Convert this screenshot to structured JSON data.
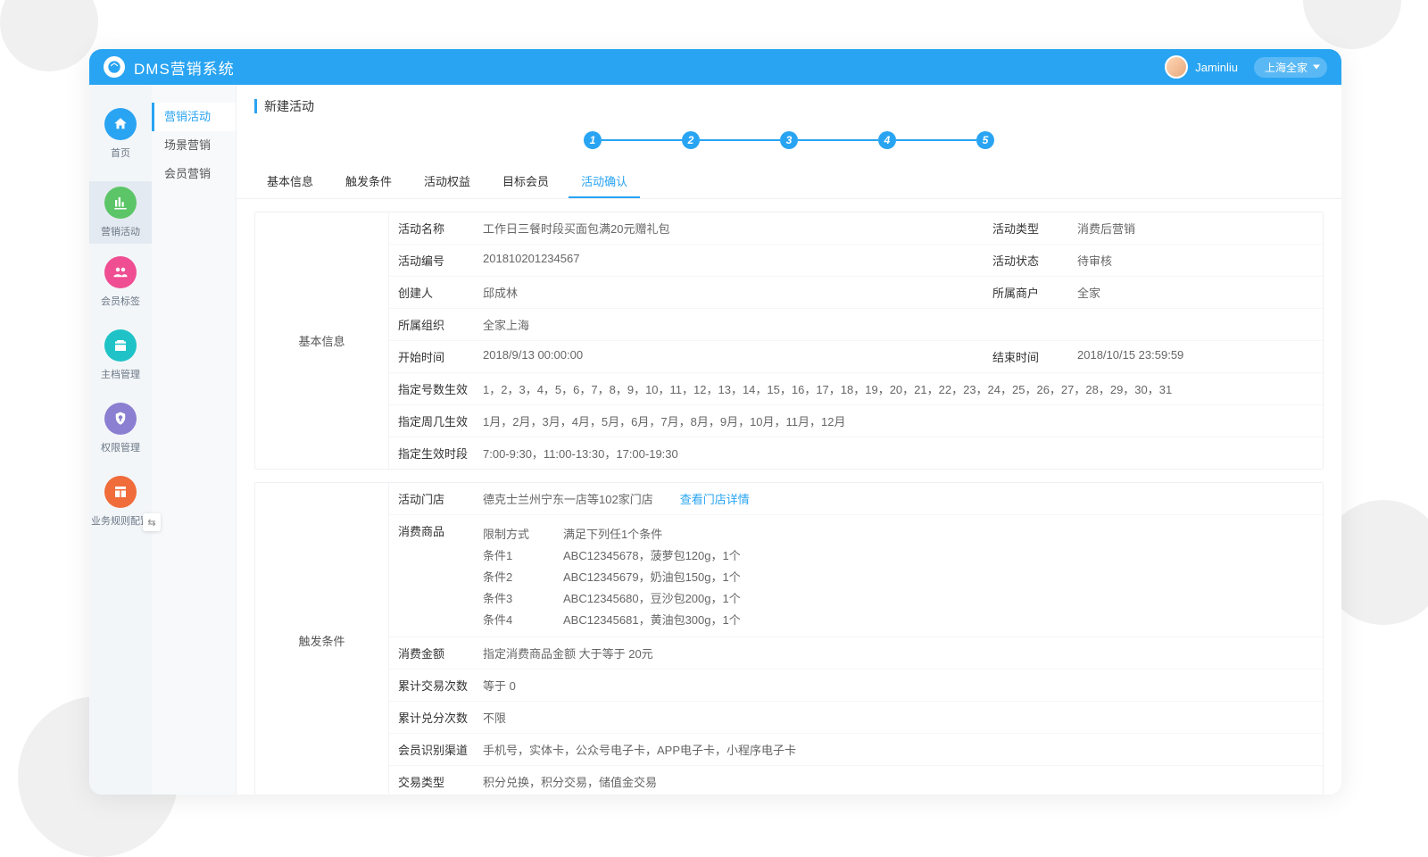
{
  "header": {
    "app_title": "DMS营销系统",
    "username": "Jaminliu",
    "org": "上海全家"
  },
  "nav_primary": [
    {
      "id": "home",
      "label": "首页",
      "color": "#29a4f2"
    },
    {
      "id": "marketing",
      "label": "营销活动",
      "color": "#5cc568",
      "active": true
    },
    {
      "id": "tags",
      "label": "会员标签",
      "color": "#ef4e92"
    },
    {
      "id": "master",
      "label": "主档管理",
      "color": "#1fc3c7"
    },
    {
      "id": "perm",
      "label": "权限管理",
      "color": "#8a7fd1"
    },
    {
      "id": "rules",
      "label": "业务规则配置",
      "color": "#f06c3a"
    }
  ],
  "nav_secondary": [
    {
      "label": "营销活动",
      "active": true
    },
    {
      "label": "场景营销"
    },
    {
      "label": "会员营销"
    }
  ],
  "page_title": "新建活动",
  "steps": [
    "1",
    "2",
    "3",
    "4",
    "5"
  ],
  "tabs": [
    {
      "label": "基本信息"
    },
    {
      "label": "触发条件"
    },
    {
      "label": "活动权益"
    },
    {
      "label": "目标会员"
    },
    {
      "label": "活动确认",
      "active": true
    }
  ],
  "basic": {
    "section_label": "基本信息",
    "rows_pair": [
      {
        "l1": "活动名称",
        "v1": "工作日三餐时段买面包满20元赠礼包",
        "l2": "活动类型",
        "v2": "消费后营销"
      },
      {
        "l1": "活动编号",
        "v1": "201810201234567",
        "l2": "活动状态",
        "v2": "待审核"
      },
      {
        "l1": "创建人",
        "v1": "邱成林",
        "l2": "所属商户",
        "v2": "全家"
      },
      {
        "l1": "所属组织",
        "v1": "全家上海",
        "l2": "",
        "v2": ""
      },
      {
        "l1": "开始时间",
        "v1": "2018/9/13 00:00:00",
        "l2": "结束时间",
        "v2": "2018/10/15 23:59:59"
      }
    ],
    "rows_full": [
      {
        "l": "指定号数生效",
        "v": "1，2，3，4，5，6，7，8，9，10，11，12，13，14，15，16，17，18，19，20，21，22，23，24，25，26，27，28，29，30，31"
      },
      {
        "l": "指定周几生效",
        "v": "1月，2月，3月，4月，5月，6月，7月，8月，9月，10月，11月，12月"
      },
      {
        "l": "指定生效时段",
        "v": "7:00-9:30，11:00-13:30，17:00-19:30"
      }
    ]
  },
  "trigger": {
    "section_label": "触发条件",
    "store": {
      "label": "活动门店",
      "value": "德克士兰州宁东一店等102家门店",
      "link": "查看门店详情"
    },
    "goods": {
      "label": "消费商品",
      "limit_label": "限制方式",
      "limit_value": "满足下列任1个条件",
      "conditions": [
        {
          "k": "条件1",
          "v": "ABC12345678，菠萝包120g，1个"
        },
        {
          "k": "条件2",
          "v": "ABC12345679，奶油包150g，1个"
        },
        {
          "k": "条件3",
          "v": "ABC12345680，豆沙包200g，1个"
        },
        {
          "k": "条件4",
          "v": "ABC12345681，黄油包300g，1个"
        }
      ]
    },
    "simple": [
      {
        "l": "消费金额",
        "v": "指定消费商品金额  大于等于  20元"
      },
      {
        "l": "累计交易次数",
        "v": "等于 0"
      },
      {
        "l": "累计兑分次数",
        "v": "不限"
      },
      {
        "l": "会员识别渠道",
        "v": "手机号，实体卡，公众号电子卡，APP电子卡，小程序电子卡"
      },
      {
        "l": "交易类型",
        "v": "积分兑换，积分交易，储值金交易"
      }
    ]
  }
}
